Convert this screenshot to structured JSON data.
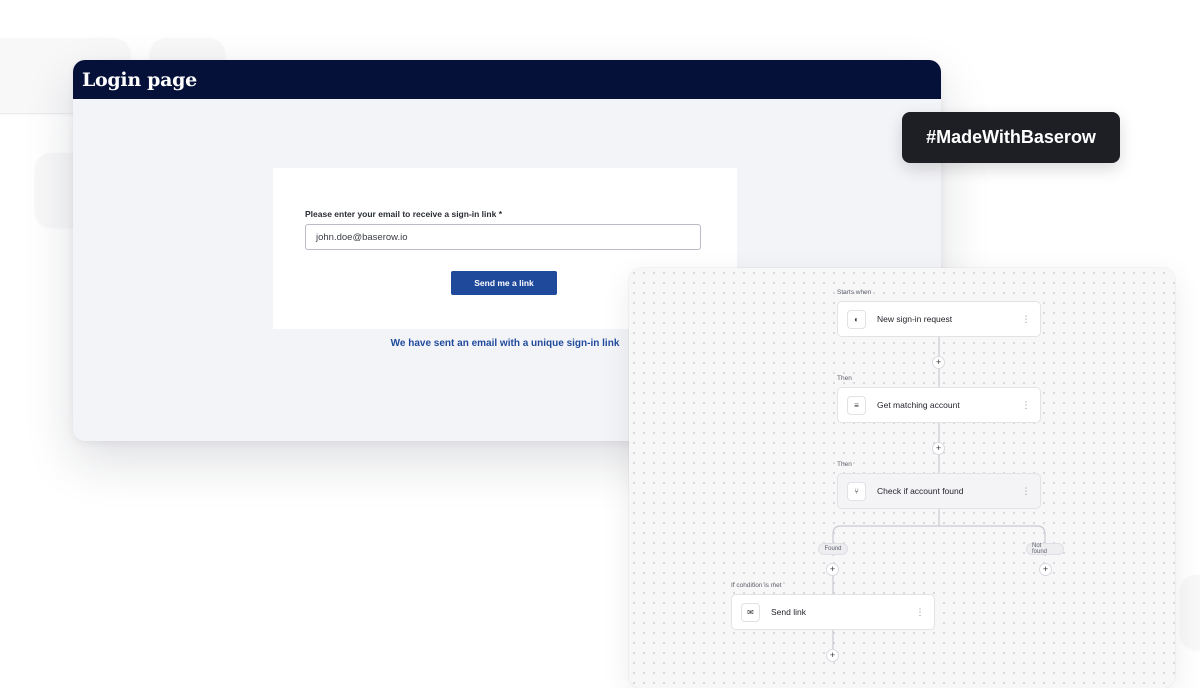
{
  "login": {
    "title": "Login page",
    "form_label": "Please enter your email to receive a sign-in link *",
    "email_value": "john.doe@baserow.io",
    "send_button": "Send me a link",
    "confirmation": "We have sent an email with a unique sign-in link"
  },
  "hashtag": "#MadeWithBaserow",
  "workflow": {
    "starts_when": "Starts when",
    "then_1": "Then",
    "then_2": "Then",
    "if_met": "If condition is met",
    "nodes": [
      {
        "label": "New sign-in request",
        "icon": "◐"
      },
      {
        "label": "Get matching account",
        "icon": "≡"
      },
      {
        "label": "Check if account found",
        "icon": "⑂"
      },
      {
        "label": "Send link",
        "icon": "✉"
      }
    ],
    "branches": {
      "found": "Found",
      "not_found": "Not found"
    },
    "menu_glyph": "⋮",
    "plus_glyph": "+"
  },
  "colors": {
    "header_navy": "#06113a",
    "button_blue": "#1f4a9c",
    "hashtag_bg": "#1e1f24"
  }
}
